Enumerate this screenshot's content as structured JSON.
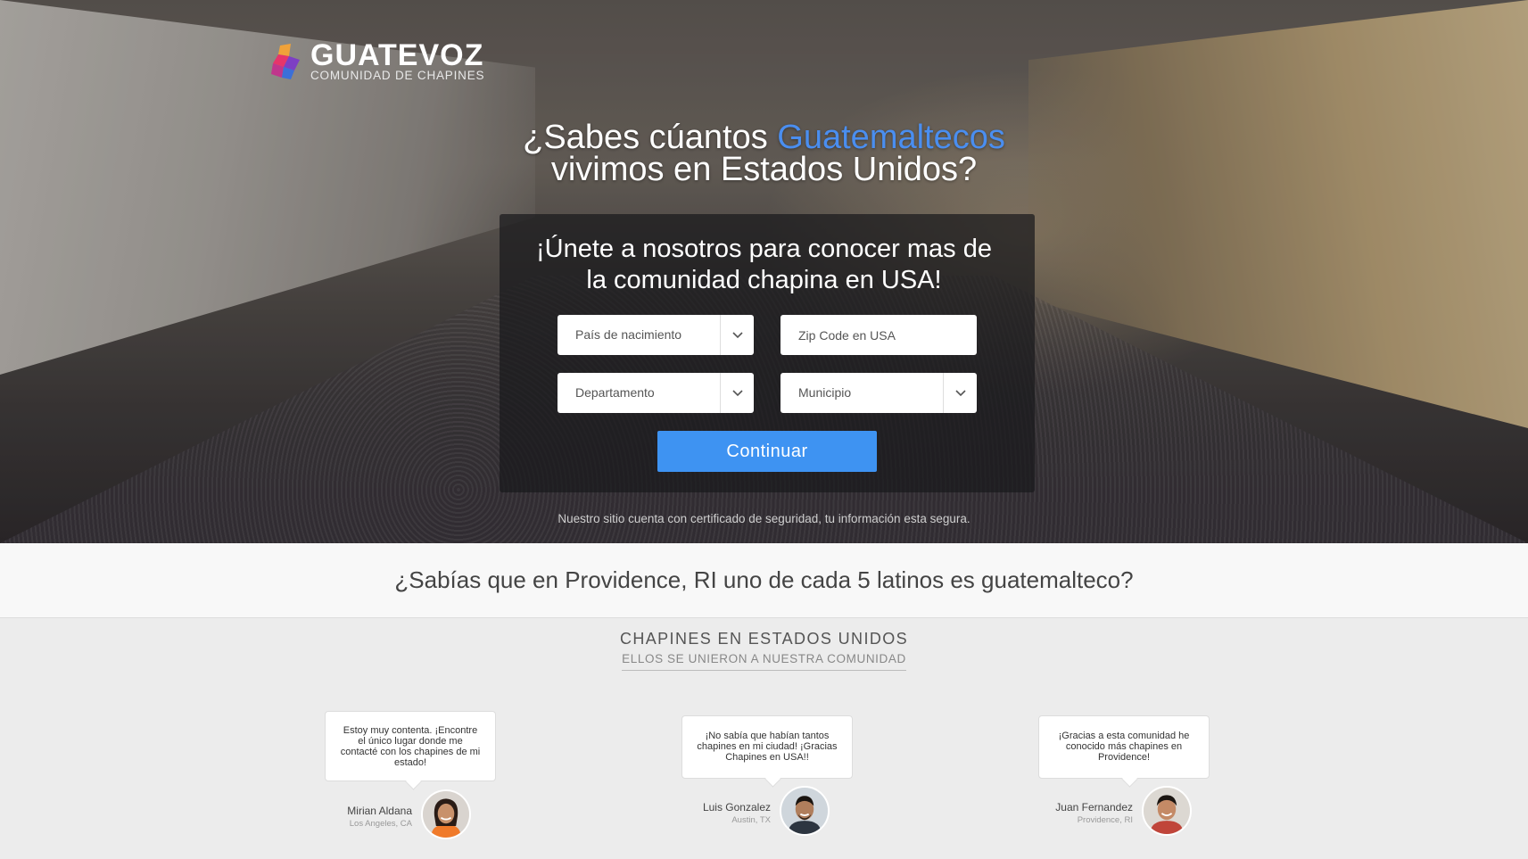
{
  "logo": {
    "brand": "GUATEVOZ",
    "tagline": "COMUNIDAD DE CHAPINES"
  },
  "hero": {
    "headline_part1": "¿Sabes cúantos ",
    "headline_accent": "Guatemaltecos",
    "headline_part2": "vivimos en Estados Unidos?",
    "accent_color": "#4a8ef0"
  },
  "form": {
    "title_line1": "¡Únete a nosotros para conocer mas de",
    "title_line2": "la comunidad chapina en USA!",
    "country_select": "País de nacimiento",
    "zip_placeholder": "Zip Code en USA",
    "department_select": "Departamento",
    "municipality_select": "Municipio",
    "submit_label": "Continuar",
    "button_color": "#3e93f2"
  },
  "security_note": "Nuestro sitio cuenta con certificado de seguridad, tu información esta segura.",
  "fact": "¿Sabías que en Providence, RI uno de cada 5 latinos es guatemalteco?",
  "community": {
    "title": "CHAPINES EN ESTADOS UNIDOS",
    "subtitle": "ELLOS SE UNIERON A NUESTRA COMUNIDAD",
    "testimonials": [
      {
        "quote": "Estoy muy contenta. ¡Encontre el único lugar donde me contacté con los chapines de mi estado!",
        "name": "Mirian Aldana",
        "location": "Los Angeles, CA"
      },
      {
        "quote": "¡No sabía que habían tantos chapines en mi ciudad! ¡Gracias Chapines en USA!!",
        "name": "Luis Gonzalez",
        "location": "Austin, TX"
      },
      {
        "quote": "¡Gracias a esta comunidad he conocido más chapines en Providence!",
        "name": "Juan Fernandez",
        "location": "Providence, RI"
      }
    ]
  }
}
